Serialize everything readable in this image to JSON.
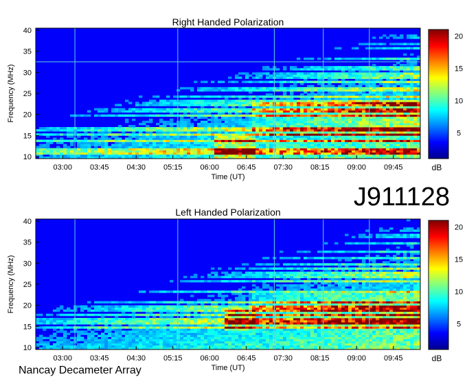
{
  "figure": {
    "dataset_id": "J911128",
    "footer": "Nancay Decameter Array"
  },
  "colors": {
    "colormap": [
      "#00008f",
      "#0000ff",
      "#0080ff",
      "#00ffff",
      "#80ff80",
      "#ffff00",
      "#ff8000",
      "#ff0000",
      "#800000"
    ],
    "line": "#5fd7e0"
  },
  "chart_data": [
    {
      "type": "heatmap",
      "title": "Right Handed Polarization",
      "xlabel": "Time (UT)",
      "ylabel": "Frequency (MHz)",
      "x_ticks": [
        "03:00",
        "03:45",
        "04:30",
        "05:15",
        "06:00",
        "06:45",
        "07:30",
        "08:15",
        "09:00",
        "09:45"
      ],
      "x_tick_hours": [
        3.0,
        3.75,
        4.5,
        5.25,
        6.0,
        6.75,
        7.5,
        8.25,
        9.0,
        9.75
      ],
      "xlim_hours": [
        2.45,
        10.3
      ],
      "y_ticks": [
        10,
        15,
        20,
        25,
        30,
        35,
        40
      ],
      "ylim": [
        9.5,
        40.5
      ],
      "colorbar": {
        "label": "dB",
        "ticks": [
          5,
          10,
          15,
          20
        ],
        "range": [
          1,
          21
        ]
      },
      "vertical_lines_hours": [
        3.25,
        5.35,
        7.32,
        8.32,
        9.26
      ],
      "horizontal_lines_mhz": [
        32.5
      ]
    },
    {
      "type": "heatmap",
      "title": "Left Handed Polarization",
      "xlabel": "Time (UT)",
      "ylabel": "Frequency (MHz)",
      "x_ticks": [
        "03:00",
        "03:45",
        "04:30",
        "05:15",
        "06:00",
        "06:45",
        "07:30",
        "08:15",
        "09:00",
        "09:45"
      ],
      "x_tick_hours": [
        3.0,
        3.75,
        4.5,
        5.25,
        6.0,
        6.75,
        7.5,
        8.25,
        9.0,
        9.75
      ],
      "xlim_hours": [
        2.45,
        10.3
      ],
      "y_ticks": [
        10,
        15,
        20,
        25,
        30,
        35,
        40
      ],
      "ylim": [
        9.5,
        40.5
      ],
      "colorbar": {
        "label": "dB",
        "ticks": [
          5,
          10,
          15,
          20
        ],
        "range": [
          1,
          21
        ]
      },
      "vertical_lines_hours": [
        3.25,
        5.35,
        7.32,
        8.32,
        9.26
      ],
      "horizontal_lines_mhz": []
    }
  ]
}
